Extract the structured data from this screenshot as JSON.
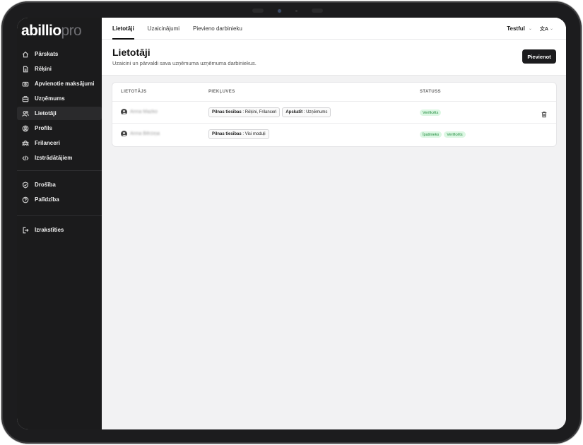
{
  "app": {
    "logo_main": "abillio",
    "logo_suffix": "pro"
  },
  "sidebar": {
    "items": [
      {
        "label": "Pārskats",
        "icon": "home-icon"
      },
      {
        "label": "Rēķini",
        "icon": "invoice-icon"
      },
      {
        "label": "Apvienotie maksājumi",
        "icon": "payments-icon"
      },
      {
        "label": "Uzņēmums",
        "icon": "briefcase-icon"
      },
      {
        "label": "Lietotāji",
        "icon": "users-icon",
        "active": true
      },
      {
        "label": "Profils",
        "icon": "profile-icon"
      },
      {
        "label": "Frilanceri",
        "icon": "freelancers-icon"
      },
      {
        "label": "Izstrādātājiem",
        "icon": "code-icon"
      }
    ],
    "secondary": [
      {
        "label": "Drošība",
        "icon": "shield-icon"
      },
      {
        "label": "Palīdzība",
        "icon": "help-icon"
      }
    ],
    "logout": {
      "label": "Izrakstīties",
      "icon": "logout-icon"
    }
  },
  "topbar": {
    "tabs": [
      {
        "label": "Lietotāji",
        "active": true
      },
      {
        "label": "Uzaicinājumi"
      },
      {
        "label": "Pievieno darbinieku"
      }
    ],
    "company": "Testful",
    "lang_icon": "translate-icon",
    "lang_glyph": "文A"
  },
  "page": {
    "title": "Lietotāji",
    "subtitle": "Uzaicini un pārvaldi sava uzņēmuma uzņēmuma darbiniekus.",
    "add_button": "Pievienot"
  },
  "table": {
    "columns": [
      "LIETOTĀJS",
      "PIEKĻUVES",
      "STATUSS"
    ],
    "rows": [
      {
        "name": "Anna Mazko",
        "access": [
          {
            "role": "Pilnas tiesības",
            "scope": "Rēķini, Frilanceri"
          },
          {
            "role": "Apskatīt",
            "scope": "Uzņēmums"
          }
        ],
        "status": [
          "Verificēts"
        ],
        "deletable": true
      },
      {
        "name": "Anna Bērziņa",
        "access": [
          {
            "role": "Pilnas tiesības",
            "scope": "Visi moduļi"
          }
        ],
        "status": [
          "Īpašnieks",
          "Verificēts"
        ],
        "deletable": false
      }
    ]
  },
  "colors": {
    "sidebar_bg": "#1b1b1c",
    "accent": "#1c1c1e",
    "badge_bg": "#dcf7e3",
    "badge_text": "#1d8a3b"
  }
}
